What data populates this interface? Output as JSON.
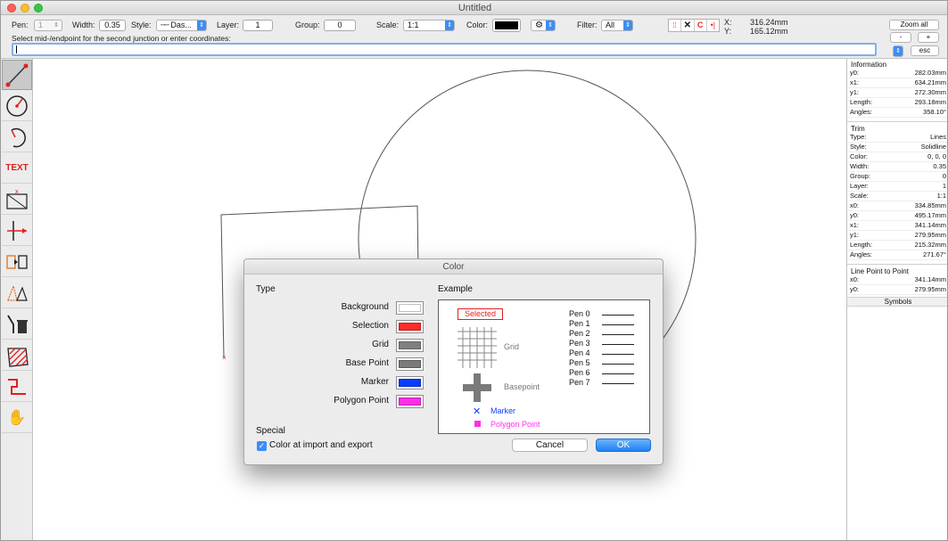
{
  "window": {
    "title": "Untitled"
  },
  "toolbar": {
    "pen_label": "Pen:",
    "pen_value": "1",
    "width_label": "Width:",
    "width_value": "0.35",
    "style_label": "Style:",
    "style_value": "Das...",
    "layer_label": "Layer:",
    "layer_value": "1",
    "group_label": "Group:",
    "group_value": "0",
    "scale_label": "Scale:",
    "scale_value": "1:1",
    "color_label": "Color:",
    "color_value": "#000000",
    "filter_label": "Filter:",
    "filter_value": "All",
    "coord_x_label": "X:",
    "coord_x_value": "316.24mm",
    "coord_y_label": "Y:",
    "coord_y_value": "165.12mm",
    "zoom_all_label": "Zoom all",
    "zoom_out_label": "-",
    "zoom_in_label": "+",
    "esc_label": "esc",
    "prompt": "Select mid-/endpoint for the second junction or enter coordinates:",
    "command_value": ""
  },
  "tools": [
    {
      "name": "line-tool",
      "icon": "line-icon",
      "active": true
    },
    {
      "name": "circle-tool",
      "icon": "circle-icon",
      "active": false
    },
    {
      "name": "arc-tool",
      "icon": "arc-icon",
      "active": false
    },
    {
      "name": "text-tool",
      "icon": "text-icon",
      "label": "TEXT",
      "active": false
    },
    {
      "name": "dimension-tool",
      "icon": "dimension-icon",
      "active": false
    },
    {
      "name": "junction-tool",
      "icon": "junction-icon",
      "active": false
    },
    {
      "name": "copy-tool",
      "icon": "copy-icon",
      "active": false
    },
    {
      "name": "transform-tool",
      "icon": "transform-icon",
      "active": false
    },
    {
      "name": "delete-tool",
      "icon": "trash-icon",
      "active": false
    },
    {
      "name": "hatch-tool",
      "icon": "hatch-icon",
      "active": false
    },
    {
      "name": "polyline-tool",
      "icon": "polyline-icon",
      "active": false
    },
    {
      "name": "pan-tool",
      "icon": "hand-icon",
      "active": false
    }
  ],
  "info_panel": {
    "information_title": "Information",
    "information_rows": [
      {
        "k": "y0:",
        "v": "282.03mm"
      },
      {
        "k": "x1:",
        "v": "634.21mm"
      },
      {
        "k": "y1:",
        "v": "272.30mm"
      },
      {
        "k": "Length:",
        "v": "293.18mm"
      },
      {
        "k": "Angles:",
        "v": "358.10°"
      }
    ],
    "trim_title": "Trim",
    "trim_rows": [
      {
        "k": "Type:",
        "v": "Lines"
      },
      {
        "k": "Style:",
        "v": "Solidline"
      },
      {
        "k": "Color:",
        "v": "0, 0, 0"
      },
      {
        "k": "Width:",
        "v": "0.35"
      },
      {
        "k": "Group:",
        "v": "0"
      },
      {
        "k": "Layer:",
        "v": "1"
      },
      {
        "k": "Scale:",
        "v": "1:1"
      },
      {
        "k": "x0:",
        "v": "334.85mm"
      },
      {
        "k": "y0:",
        "v": "495.17mm"
      },
      {
        "k": "x1:",
        "v": "341.14mm"
      },
      {
        "k": "y1:",
        "v": "279.95mm"
      },
      {
        "k": "Length:",
        "v": "215.32mm"
      },
      {
        "k": "Angles:",
        "v": "271.67°"
      }
    ],
    "lpp_title": "Line Point to Point",
    "lpp_rows": [
      {
        "k": "x0:",
        "v": "341.14mm"
      },
      {
        "k": "y0:",
        "v": "279.95mm"
      }
    ],
    "symbols_tab": "Symbols"
  },
  "dialog": {
    "title": "Color",
    "type_heading": "Type",
    "example_heading": "Example",
    "color_types": [
      {
        "label": "Background",
        "color": "#ffffff"
      },
      {
        "label": "Selection",
        "color": "#ff2a2a"
      },
      {
        "label": "Grid",
        "color": "#808080"
      },
      {
        "label": "Base Point",
        "color": "#7a7a7a"
      },
      {
        "label": "Marker",
        "color": "#0a3cff"
      },
      {
        "label": "Polygon Point",
        "color": "#ff2ee8"
      }
    ],
    "special_heading": "Special",
    "checkbox_label": "Color at import and export",
    "checkbox_checked": true,
    "cancel_label": "Cancel",
    "ok_label": "OK",
    "example": {
      "selected_label": "Selected",
      "grid_label": "Grid",
      "basepoint_label": "Basepoint",
      "marker_label": "Marker",
      "polygon_point_label": "Polygon Point",
      "pens": [
        "Pen 0",
        "Pen 1",
        "Pen 2",
        "Pen 3",
        "Pen 4",
        "Pen 5",
        "Pen 6",
        "Pen 7"
      ]
    }
  }
}
